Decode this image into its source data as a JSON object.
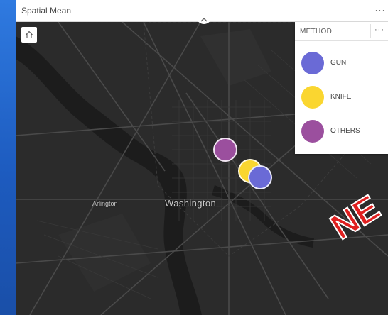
{
  "widget": {
    "title": "Spatial Mean",
    "more_label": "···"
  },
  "map": {
    "labels": {
      "arlington": "Arlington",
      "washington": "Washington"
    },
    "home_icon": "home-icon",
    "points": [
      {
        "method": "OTHERS",
        "color": "#9b4f9e"
      },
      {
        "method": "KNIFE",
        "color": "#fad630"
      },
      {
        "method": "GUN",
        "color": "#6a6ad6"
      }
    ]
  },
  "legend": {
    "title": "METHOD",
    "more_label": "···",
    "items": [
      {
        "label": "GUN",
        "color": "#6a6ad6"
      },
      {
        "label": "KNIFE",
        "color": "#fad630"
      },
      {
        "label": "OTHERS",
        "color": "#9b4f9e"
      }
    ]
  },
  "overlay": {
    "text": "NE"
  },
  "colors": {
    "map_background": "#2b2b2b",
    "roads": "#4a4a4a",
    "water": "#1c1c1c",
    "desktop": "#1f5fc8"
  }
}
